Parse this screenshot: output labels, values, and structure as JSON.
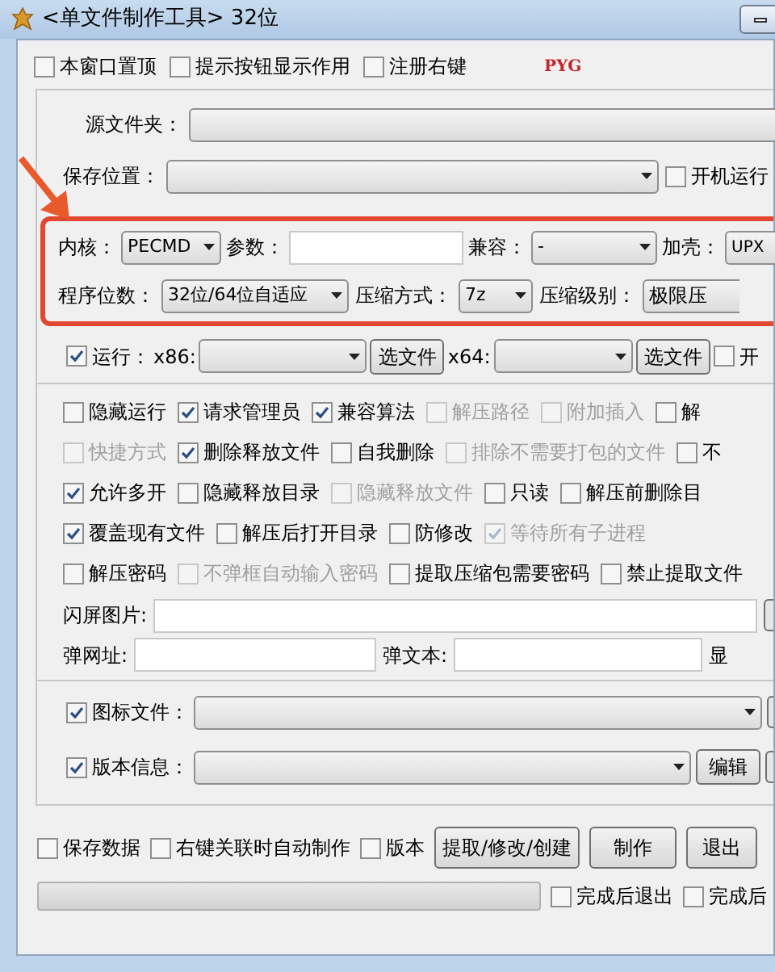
{
  "window": {
    "title": "<单文件制作工具> 32位"
  },
  "top_options": [
    {
      "label": "本窗口置顶",
      "checked": false
    },
    {
      "label": "提示按钮显示作用",
      "checked": false
    },
    {
      "label": "注册右键",
      "checked": false
    }
  ],
  "badge": "PYG",
  "source_folder": {
    "label": "源文件夹："
  },
  "save_location": {
    "label": "保存位置："
  },
  "startup_run": {
    "label": "开机运行",
    "checked": false
  },
  "core_settings": {
    "kernel": {
      "label": "内核：",
      "value": "PECMD"
    },
    "params": {
      "label": "参数："
    },
    "compat": {
      "label": "兼容：",
      "value": "-"
    },
    "packer": {
      "label": "加壳：",
      "value": "UPX"
    },
    "bits": {
      "label": "程序位数：",
      "value": "32位/64位自适应"
    },
    "compress_method": {
      "label": "压缩方式：",
      "value": "7z"
    },
    "compress_level": {
      "label": "压缩级别：",
      "value": "极限压"
    }
  },
  "run_row": {
    "label": "运行：",
    "checked": true,
    "x86_label": "x86:",
    "x64_label": "x64:",
    "browse_buttons": [
      "选文件",
      "选文件"
    ],
    "trailing": {
      "label": "开",
      "checked": false
    }
  },
  "option_rows": [
    [
      {
        "label": "隐藏运行",
        "checked": false,
        "disabled": false
      },
      {
        "label": "请求管理员",
        "checked": true,
        "disabled": false
      },
      {
        "label": "兼容算法",
        "checked": true,
        "disabled": false
      },
      {
        "label": "解压路径",
        "checked": false,
        "disabled": true
      },
      {
        "label": "附加插入",
        "checked": false,
        "disabled": true
      },
      {
        "label": "解",
        "checked": false,
        "disabled": false
      }
    ],
    [
      {
        "label": "快捷方式",
        "checked": false,
        "disabled": true
      },
      {
        "label": "删除释放文件",
        "checked": true,
        "disabled": false
      },
      {
        "label": "自我删除",
        "checked": false,
        "disabled": false
      },
      {
        "label": "排除不需要打包的文件",
        "checked": false,
        "disabled": true
      },
      {
        "label": "不",
        "checked": false,
        "disabled": false
      }
    ],
    [
      {
        "label": "允许多开",
        "checked": true,
        "disabled": false
      },
      {
        "label": "隐藏释放目录",
        "checked": false,
        "disabled": false
      },
      {
        "label": "隐藏释放文件",
        "checked": false,
        "disabled": true
      },
      {
        "label": "只读",
        "checked": false,
        "disabled": false
      },
      {
        "label": "解压前删除目",
        "checked": false,
        "disabled": false
      }
    ],
    [
      {
        "label": "覆盖现有文件",
        "checked": true,
        "disabled": false
      },
      {
        "label": "解压后打开目录",
        "checked": false,
        "disabled": false
      },
      {
        "label": "防修改",
        "checked": false,
        "disabled": false
      },
      {
        "label": "等待所有子进程",
        "checked": true,
        "disabled": true
      }
    ],
    [
      {
        "label": "解压密码",
        "checked": false,
        "disabled": false
      },
      {
        "label": "不弹框自动输入密码",
        "checked": false,
        "disabled": true
      },
      {
        "label": "提取压缩包需要密码",
        "checked": false,
        "disabled": false
      },
      {
        "label": "禁止提取文件",
        "checked": false,
        "disabled": false
      }
    ]
  ],
  "splash": {
    "label": "闪屏图片:"
  },
  "popup_url": {
    "label": "弹网址:"
  },
  "popup_text": {
    "label": "弹文本:"
  },
  "show_label": "显",
  "icon_file": {
    "label": "图标文件：",
    "checked": true
  },
  "version_info": {
    "label": "版本信息：",
    "checked": true,
    "edit_button": "编辑"
  },
  "bottom_options": [
    {
      "label": "保存数据",
      "checked": false
    },
    {
      "label": "右键关联时自动制作",
      "checked": false
    },
    {
      "label": "版本",
      "checked": false
    }
  ],
  "buttons": [
    "提取/修改/创建",
    "制作",
    "退出"
  ],
  "progress": {
    "level": 0
  },
  "finish_options": [
    {
      "label": "完成后退出",
      "checked": false
    },
    {
      "label": "完成后",
      "checked": false
    }
  ]
}
